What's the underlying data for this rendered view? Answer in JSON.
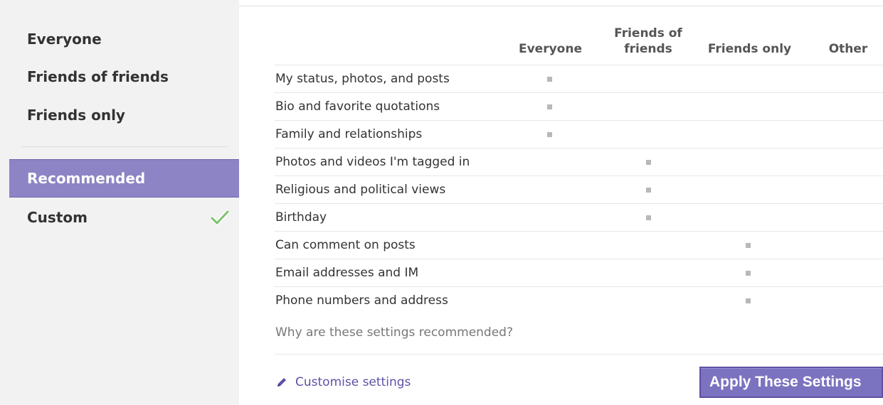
{
  "sidebar": {
    "items": [
      {
        "label": "Everyone"
      },
      {
        "label": "Friends of friends"
      },
      {
        "label": "Friends only"
      },
      {
        "label": "Recommended"
      },
      {
        "label": "Custom"
      }
    ],
    "selected": "Recommended"
  },
  "table": {
    "columns": [
      "Everyone",
      "Friends of friends",
      "Friends only",
      "Other"
    ],
    "rows": [
      {
        "label": "My status, photos, and posts",
        "level": "Everyone"
      },
      {
        "label": "Bio and favorite quotations",
        "level": "Everyone"
      },
      {
        "label": "Family and relationships",
        "level": "Everyone"
      },
      {
        "label": "Photos and videos I'm tagged in",
        "level": "Friends of friends"
      },
      {
        "label": "Religious and political views",
        "level": "Friends of friends"
      },
      {
        "label": "Birthday",
        "level": "Friends of friends"
      },
      {
        "label": "Can comment on posts",
        "level": "Friends only"
      },
      {
        "label": "Email addresses and IM",
        "level": "Friends only"
      },
      {
        "label": "Phone numbers and address",
        "level": "Friends only"
      }
    ]
  },
  "footer": {
    "why_link": "Why are these settings recommended?",
    "customise_label": "Customise settings",
    "apply_label": "Apply These Settings"
  },
  "colors": {
    "accent": "#8c84c4",
    "button": "#7b72c0",
    "link": "#5b52a8",
    "check": "#7cc36a"
  },
  "icons": [
    "check-icon",
    "pencil-icon"
  ]
}
